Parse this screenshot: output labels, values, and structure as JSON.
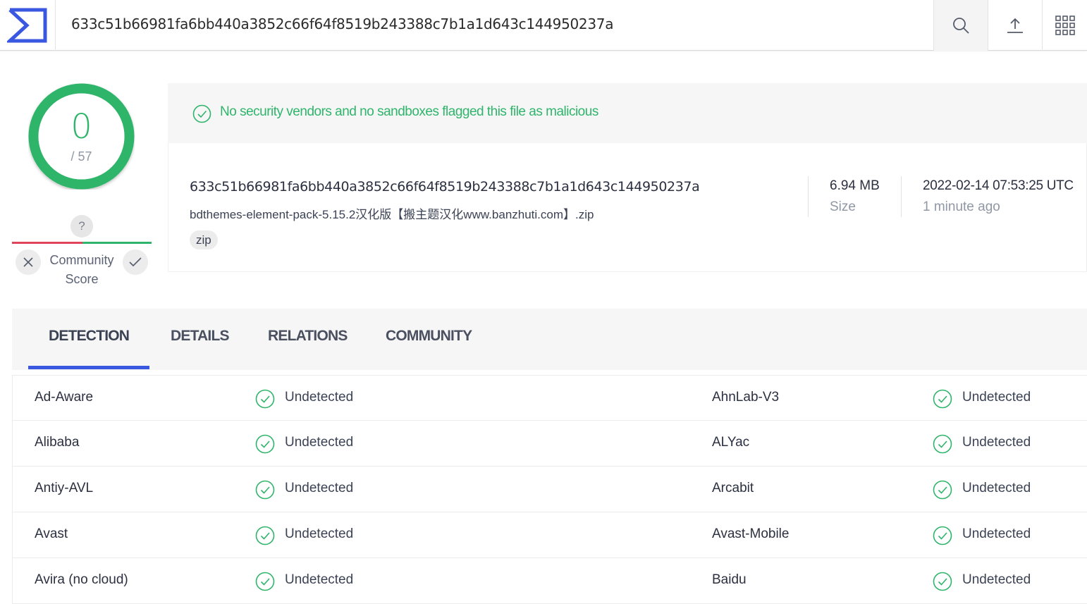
{
  "topbar": {
    "search_value": "633c51b66981fa6bb440a3852c66f64f8519b243388c7b1a1d643c144950237a"
  },
  "score": {
    "detections": "0",
    "total": "/ 57"
  },
  "community": {
    "unknown_symbol": "?",
    "label_line1": "Community",
    "label_line2": "Score"
  },
  "banner": {
    "message": "No security vendors and no sandboxes flagged this file as malicious"
  },
  "file": {
    "hash": "633c51b66981fa6bb440a3852c66f64f8519b243388c7b1a1d643c144950237a",
    "name": "bdthemes-element-pack-5.15.2汉化版【搬主题汉化www.banzhuti.com】.zip",
    "tag": "zip",
    "size_value": "6.94 MB",
    "size_label": "Size",
    "date_value": "2022-02-14 07:53:25 UTC",
    "date_relative": "1 minute ago"
  },
  "tabs": [
    "DETECTION",
    "DETAILS",
    "RELATIONS",
    "COMMUNITY"
  ],
  "detections": [
    {
      "left_vendor": "Ad-Aware",
      "left_status": "Undetected",
      "right_vendor": "AhnLab-V3",
      "right_status": "Undetected"
    },
    {
      "left_vendor": "Alibaba",
      "left_status": "Undetected",
      "right_vendor": "ALYac",
      "right_status": "Undetected"
    },
    {
      "left_vendor": "Antiy-AVL",
      "left_status": "Undetected",
      "right_vendor": "Arcabit",
      "right_status": "Undetected"
    },
    {
      "left_vendor": "Avast",
      "left_status": "Undetected",
      "right_vendor": "Avast-Mobile",
      "right_status": "Undetected"
    },
    {
      "left_vendor": "Avira (no cloud)",
      "left_status": "Undetected",
      "right_vendor": "Baidu",
      "right_status": "Undetected"
    }
  ],
  "colors": {
    "accent": "#3a57e0",
    "clean": "#2fb56b",
    "negative": "#e0445a"
  }
}
